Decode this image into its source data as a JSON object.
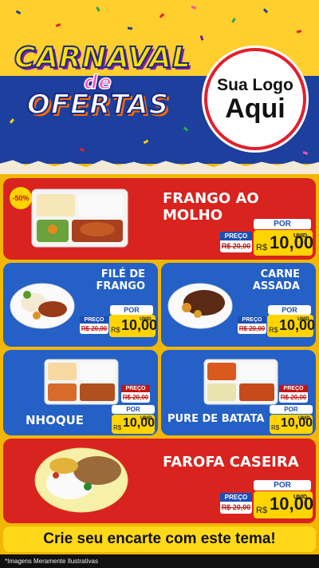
{
  "header": {
    "title_line1": "CARNAVAL",
    "title_line2": "de",
    "title_line3": "OFERTAS",
    "logo_line1": "Sua Logo",
    "logo_line2": "Aqui"
  },
  "products": [
    {
      "name": "FRANGO AO MOLHO",
      "badge": "-50%",
      "por": "POR",
      "preco": "PREÇO",
      "old": "R$ 20,00",
      "currency": "R$",
      "price": "10,00",
      "unit": "UNID"
    },
    {
      "name": "FILÉ DE FRANGO",
      "por": "POR",
      "preco": "PREÇO",
      "old": "R$ 20,00",
      "currency": "R$",
      "price": "10,00",
      "unit": "UNID"
    },
    {
      "name": "CARNE ASSADA",
      "por": "POR",
      "preco": "PREÇO",
      "old": "R$ 20,00",
      "currency": "R$",
      "price": "10,00",
      "unit": "UNID"
    },
    {
      "name": "NHOQUE",
      "por": "POR",
      "preco": "PREÇO",
      "old": "R$ 20,00",
      "currency": "R$",
      "price": "10,00",
      "unit": "UNID"
    },
    {
      "name": "PURE DE BATATA",
      "por": "POR",
      "preco": "PREÇO",
      "old": "R$ 20,00",
      "currency": "R$",
      "price": "10,00",
      "unit": "UNID"
    },
    {
      "name": "FAROFA CASEIRA",
      "por": "POR",
      "preco": "PREÇO",
      "old": "R$ 20,00",
      "currency": "R$",
      "price": "10,00",
      "unit": "UNID"
    }
  ],
  "footer": {
    "cta": "Crie seu encarte com este tema!",
    "disclaimer": "*Imagens Meramente Ilustrativas"
  },
  "colors": {
    "red": "#d8231f",
    "blue": "#2460c6",
    "yellow": "#ffd400"
  }
}
